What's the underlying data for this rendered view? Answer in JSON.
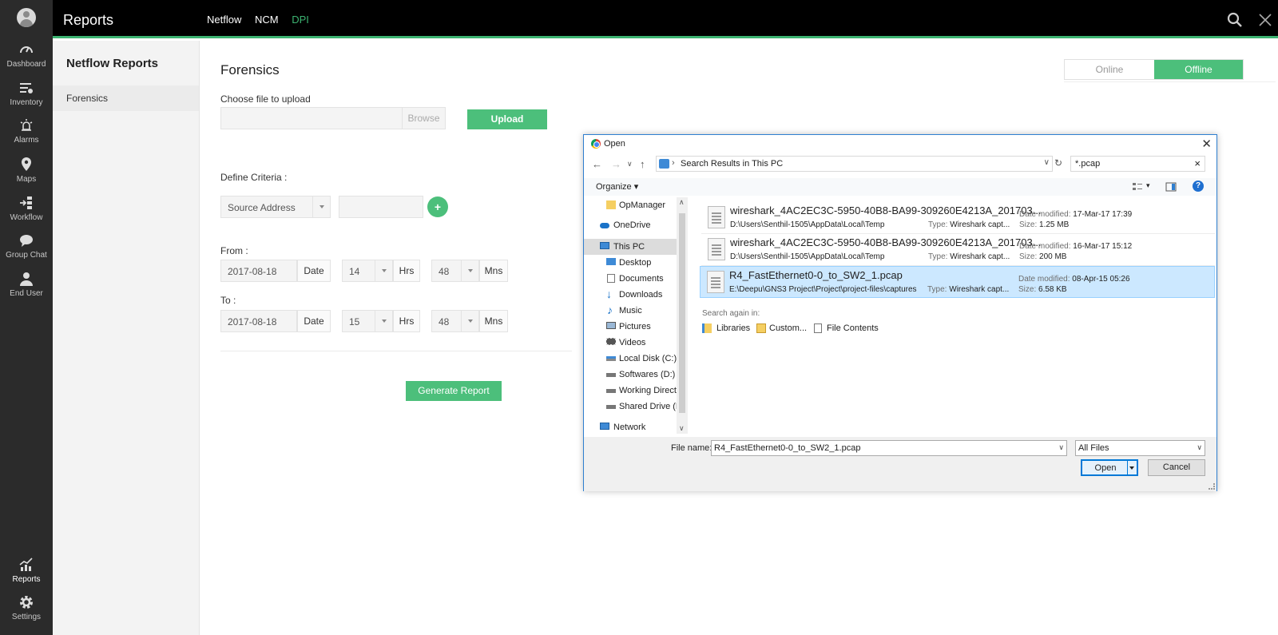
{
  "rail": {
    "items": [
      {
        "label": "Dashboard",
        "icon": "speedometer-icon"
      },
      {
        "label": "Inventory",
        "icon": "inventory-icon"
      },
      {
        "label": "Alarms",
        "icon": "alarm-icon"
      },
      {
        "label": "Maps",
        "icon": "map-pin-icon"
      },
      {
        "label": "Workflow",
        "icon": "workflow-icon"
      },
      {
        "label": "Group Chat",
        "icon": "chat-icon"
      },
      {
        "label": "End User",
        "icon": "user-icon"
      }
    ],
    "bottom": [
      {
        "label": "Reports",
        "icon": "reports-icon"
      },
      {
        "label": "Settings",
        "icon": "gear-icon"
      }
    ]
  },
  "header": {
    "title": "Reports",
    "nav": [
      "Netflow",
      "NCM",
      "DPI"
    ],
    "active_nav": "DPI",
    "accent": "#3cb371"
  },
  "submenu": {
    "heading": "Netflow Reports",
    "items": [
      "Forensics"
    ]
  },
  "main": {
    "title": "Forensics",
    "mode": {
      "online": "Online",
      "offline": "Offline",
      "selected": "Offline"
    },
    "upload": {
      "label": "Choose file to upload",
      "browse": "Browse",
      "button": "Upload"
    },
    "criteria": {
      "label": "Define Criteria :",
      "select": "Source Address",
      "value": "",
      "add": "+"
    },
    "from": {
      "label": "From :",
      "date": "2017-08-18",
      "date_unit": "Date",
      "hour": "14",
      "hour_unit": "Hrs",
      "min": "48",
      "min_unit": "Mns"
    },
    "to": {
      "label": "To :",
      "date": "2017-08-18",
      "date_unit": "Date",
      "hour": "15",
      "hour_unit": "Hrs",
      "min": "48",
      "min_unit": "Mns"
    },
    "generate": "Generate Report"
  },
  "dialog": {
    "title": "Open",
    "close": "✕",
    "address": "Search Results in This PC",
    "search": "*.pcap",
    "organize": "Organize",
    "nav": [
      {
        "label": "OpManager",
        "icon": "folder-icon"
      },
      {
        "label": "OneDrive",
        "icon": "cloud-icon"
      },
      {
        "label": "This PC",
        "icon": "computer-icon",
        "selected": true
      },
      {
        "label": "Desktop",
        "icon": "desktop-icon"
      },
      {
        "label": "Documents",
        "icon": "documents-icon"
      },
      {
        "label": "Downloads",
        "icon": "download-icon"
      },
      {
        "label": "Music",
        "icon": "music-icon"
      },
      {
        "label": "Pictures",
        "icon": "pictures-icon"
      },
      {
        "label": "Videos",
        "icon": "videos-icon"
      },
      {
        "label": "Local Disk (C:)",
        "icon": "drive-icon"
      },
      {
        "label": "Softwares (D:)",
        "icon": "drive-icon"
      },
      {
        "label": "Working Directo",
        "icon": "drive-icon"
      },
      {
        "label": "Shared Drive (F:)",
        "icon": "drive-icon"
      },
      {
        "label": "Network",
        "icon": "network-icon"
      }
    ],
    "files": [
      {
        "name": "wireshark_4AC2EC3C-5950-40B8-BA99-309260E4213A_201703...",
        "path": "D:\\Users\\Senthil-1505\\AppData\\Local\\Temp",
        "type_label": "Type:",
        "type": "Wireshark capt...",
        "date_label": "Date modified:",
        "date": "17-Mar-17 17:39",
        "size_label": "Size:",
        "size": "1.25 MB"
      },
      {
        "name": "wireshark_4AC2EC3C-5950-40B8-BA99-309260E4213A_201703...",
        "path": "D:\\Users\\Senthil-1505\\AppData\\Local\\Temp",
        "type_label": "Type:",
        "type": "Wireshark capt...",
        "date_label": "Date modified:",
        "date": "16-Mar-17 15:12",
        "size_label": "Size:",
        "size": "200 MB"
      },
      {
        "name": "R4_FastEthernet0-0_to_SW2_1.pcap",
        "path": "E:\\Deepu\\GNS3 Project\\Project\\project-files\\captures",
        "type_label": "Type:",
        "type": "Wireshark capt...",
        "date_label": "Date modified:",
        "date": "08-Apr-15 05:26",
        "size_label": "Size:",
        "size": "6.58 KB",
        "selected": true
      }
    ],
    "search_again": "Search again in:",
    "search_links": [
      "Libraries",
      "Custom...",
      "File Contents"
    ],
    "filename_label": "File name:",
    "filename": "R4_FastEthernet0-0_to_SW2_1.pcap",
    "filetype": "All Files",
    "open": "Open",
    "cancel": "Cancel"
  }
}
